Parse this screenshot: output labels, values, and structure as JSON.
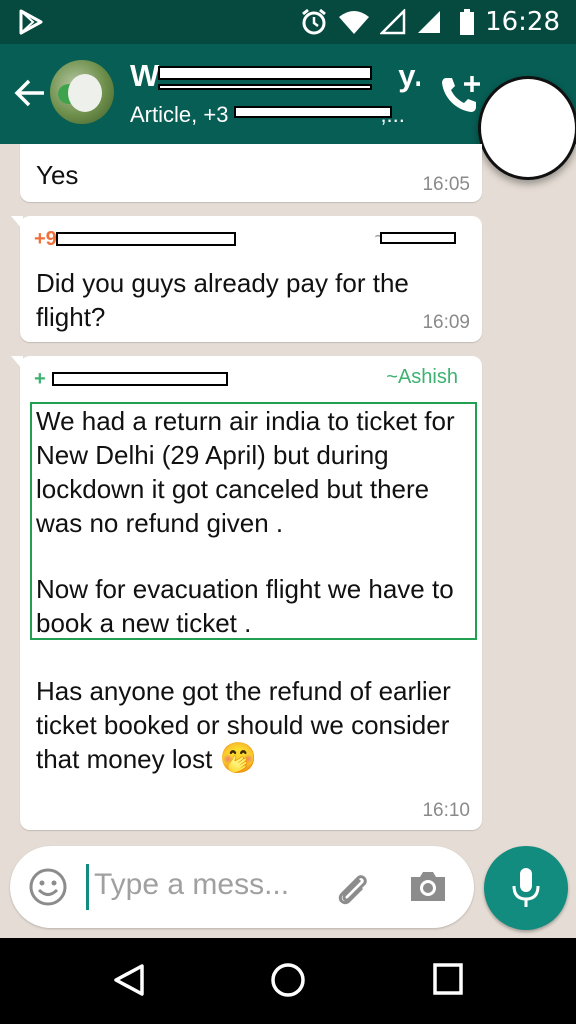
{
  "status_bar": {
    "time": "16:28",
    "icons": [
      "play-store-icon",
      "alarm-icon",
      "wifi-icon",
      "signal-icon",
      "signal-full-icon",
      "battery-icon"
    ]
  },
  "header": {
    "title": "W",
    "title_suffix": "y...",
    "subtitle": "Article, +3",
    "subtitle_suffix": ",...",
    "icons": [
      "back-arrow-icon",
      "add-call-icon"
    ]
  },
  "messages": [
    {
      "text": "Yes",
      "time": "16:05"
    },
    {
      "sender": "+9",
      "alias": "~",
      "text": "Did you guys already pay for the flight?",
      "time": "16:09"
    },
    {
      "sender": "+",
      "alias": "~Ashish",
      "paragraphs": [
        "We had a  return air india to ticket for New Delhi (29 April)  but during lockdown it got canceled but there was no refund given .",
        "Now for evacuation flight we have to book a new ticket .",
        "Has anyone got the refund of earlier ticket booked or should we consider that money lost"
      ],
      "emoji": "🤭",
      "time": "16:10"
    }
  ],
  "composer": {
    "placeholder": "Type a mess..."
  },
  "colors": {
    "header": "#075e54",
    "status_bar": "#06493f",
    "accent": "#128c7e",
    "sender_red": "#f0703a",
    "sender_green": "#3cb371",
    "highlight": "#20a050",
    "wallpaper": "#e5ddd5"
  }
}
